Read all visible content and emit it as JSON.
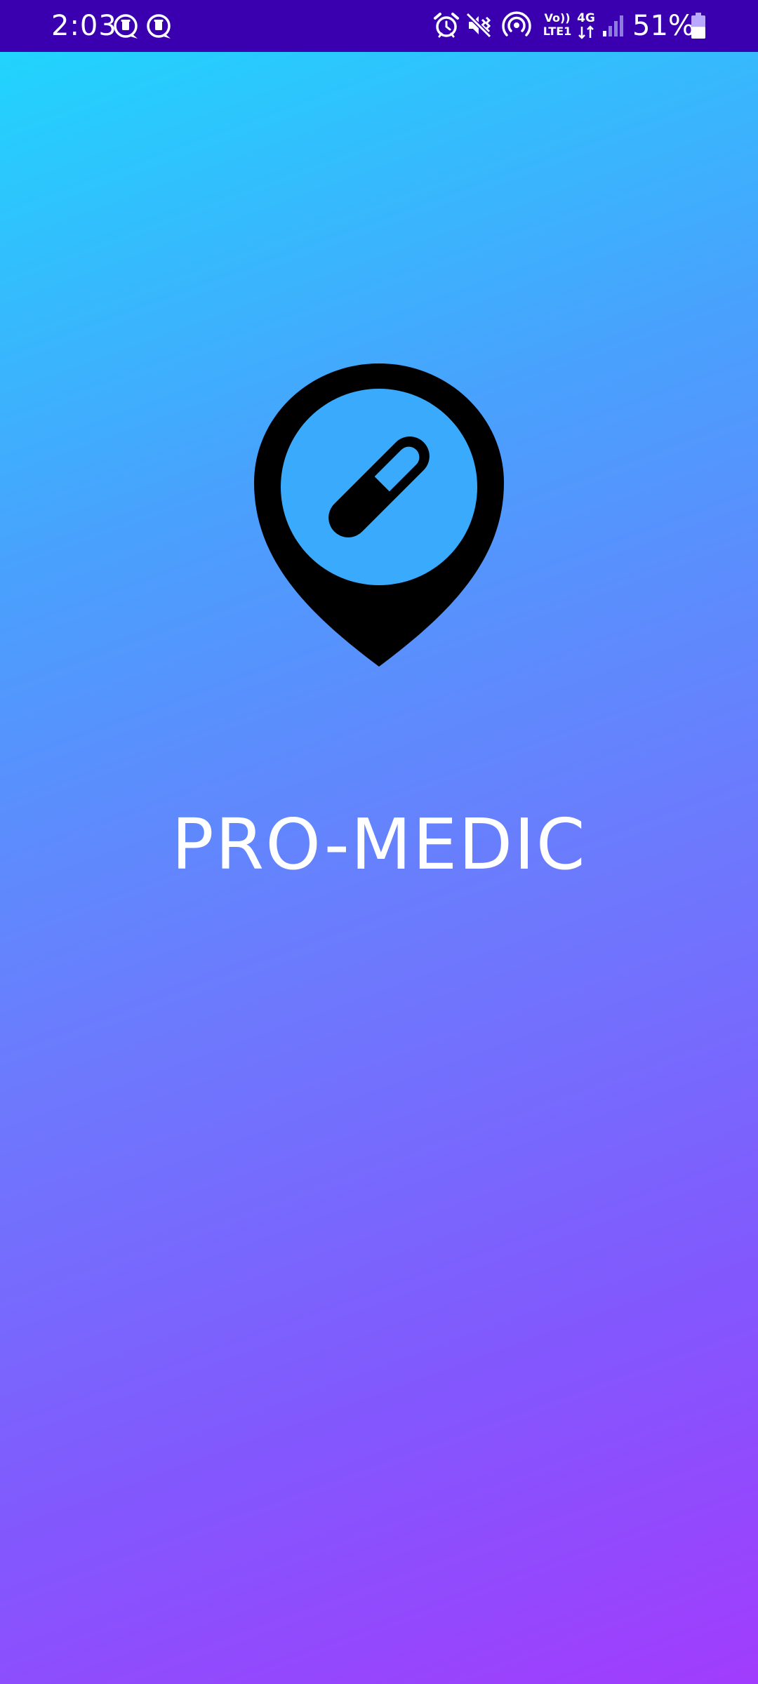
{
  "status_bar": {
    "time": "2:03",
    "volte_line1": "Vo))",
    "volte_line2": "LTE1",
    "network_type": "4G",
    "battery_percent": "51%",
    "battery_level": 0.51,
    "background_color": "#3a00b0",
    "icons": [
      "notification-icon",
      "notification-icon",
      "alarm-icon",
      "mute-icon",
      "hotspot-icon",
      "volte-icon",
      "4g-data-icon",
      "signal-icon",
      "battery-icon"
    ]
  },
  "splash": {
    "title": "PRO-MEDIC",
    "logo_icon": "map-pin-pill-icon",
    "gradient_colors": [
      "#21d4fd",
      "#4aa0fd",
      "#6a7dfd",
      "#8258fd",
      "#a13cfd"
    ],
    "title_color": "#ffffff"
  }
}
